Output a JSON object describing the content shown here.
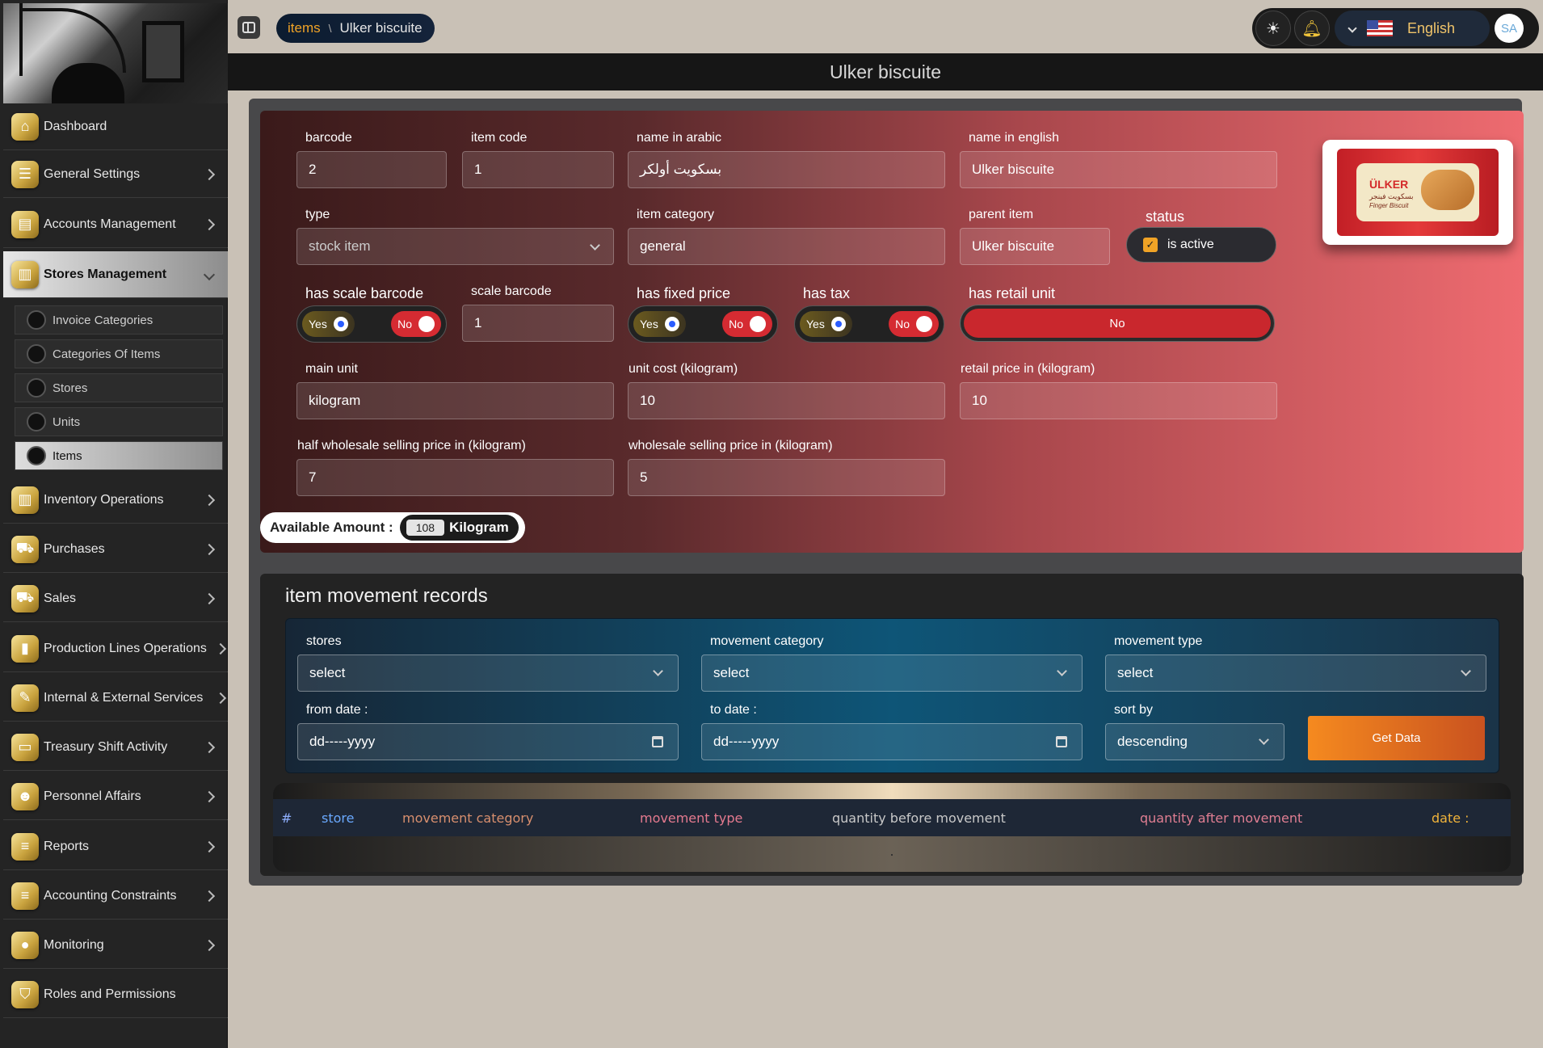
{
  "breadcrumb": {
    "parent": "items",
    "separator": "\\",
    "current": "Ulker biscuite"
  },
  "page_title": "Ulker biscuite",
  "language": "English",
  "avatar_initials": "SA",
  "sidebar": {
    "items": [
      {
        "label": "Dashboard",
        "icon": "home-icon",
        "has_children": false
      },
      {
        "label": "General Settings",
        "icon": "sliders-icon",
        "has_children": true
      },
      {
        "label": "Accounts Management",
        "icon": "wallet-icon",
        "has_children": true
      },
      {
        "label": "Stores Management",
        "icon": "building-icon",
        "has_children": true,
        "active": true
      },
      {
        "label": "Inventory Operations",
        "icon": "building-icon",
        "has_children": true
      },
      {
        "label": "Purchases",
        "icon": "cart-icon",
        "has_children": true
      },
      {
        "label": "Sales",
        "icon": "cart-icon",
        "has_children": true
      },
      {
        "label": "Production Lines Operations",
        "icon": "columns-icon",
        "has_children": true
      },
      {
        "label": "Internal & External Services",
        "icon": "tools-icon",
        "has_children": true
      },
      {
        "label": "Treasury Shift Activity",
        "icon": "cash-icon",
        "has_children": true
      },
      {
        "label": "Personnel Affairs",
        "icon": "people-icon",
        "has_children": true
      },
      {
        "label": "Reports",
        "icon": "list-icon",
        "has_children": true
      },
      {
        "label": "Accounting Constraints",
        "icon": "list-icon",
        "has_children": true
      },
      {
        "label": "Monitoring",
        "icon": "circle-icon",
        "has_children": true
      },
      {
        "label": "Roles and Permissions",
        "icon": "shield-icon",
        "has_children": false
      }
    ],
    "sub_items": [
      {
        "label": "Invoice Categories"
      },
      {
        "label": "Categories Of Items"
      },
      {
        "label": "Stores"
      },
      {
        "label": "Units"
      },
      {
        "label": "Items",
        "active": true
      }
    ]
  },
  "form": {
    "barcode": {
      "label": "barcode",
      "value": "2"
    },
    "item_code": {
      "label": "item code",
      "value": "1"
    },
    "name_ar": {
      "label": "name in arabic",
      "value": "بسكويت أولكر"
    },
    "name_en": {
      "label": "name in english",
      "value": "Ulker biscuite"
    },
    "type": {
      "label": "type",
      "value": "stock item"
    },
    "item_category": {
      "label": "item category",
      "value": "general"
    },
    "parent_item": {
      "label": "parent item",
      "value": "Ulker biscuite"
    },
    "status": {
      "label": "status",
      "value": "is active",
      "checked": true
    },
    "has_scale_barcode": {
      "label": "has scale barcode",
      "yes": "Yes",
      "no": "No",
      "selected": "Yes"
    },
    "scale_barcode": {
      "label": "scale barcode",
      "value": "1"
    },
    "has_fixed_price": {
      "label": "has fixed price",
      "yes": "Yes",
      "no": "No",
      "selected": "Yes"
    },
    "has_tax": {
      "label": "has tax",
      "yes": "Yes",
      "no": "No",
      "selected": "Yes"
    },
    "has_retail_unit": {
      "label": "has retail unit",
      "value": "No"
    },
    "main_unit": {
      "label": "main unit",
      "value": "kilogram"
    },
    "unit_cost": {
      "label": "unit cost (kilogram)",
      "value": "10"
    },
    "retail_price": {
      "label": "retail price in (kilogram)",
      "value": "10"
    },
    "half_wholesale": {
      "label": "half wholesale selling price in (kilogram)",
      "value": "7"
    },
    "wholesale": {
      "label": "wholesale selling price in (kilogram)",
      "value": "5"
    }
  },
  "product_image": {
    "brand": "ÜLKER",
    "subtitle_ar": "بسكويت فينجر",
    "subtitle_en": "Finger Biscuit"
  },
  "available": {
    "label": "Available Amount :",
    "value": "108",
    "unit": "Kilogram"
  },
  "movement": {
    "title": "item movement records",
    "filters": {
      "stores": {
        "label": "stores",
        "value": "select"
      },
      "movement_category": {
        "label": "movement category",
        "value": "select"
      },
      "movement_type": {
        "label": "movement type",
        "value": "select"
      },
      "from_date": {
        "label": "from date :",
        "value": "dd-----yyyy"
      },
      "to_date": {
        "label": "to date :",
        "value": "dd-----yyyy"
      },
      "sort_by": {
        "label": "sort by",
        "value": "descending"
      }
    },
    "get_data_label": "Get Data",
    "columns": [
      {
        "label": "#",
        "color": "#8fb0ff"
      },
      {
        "label": "store",
        "color": "#6aa9ff"
      },
      {
        "label": "movement category",
        "color": "#d88f6e"
      },
      {
        "label": "movement type",
        "color": "#e57a8f"
      },
      {
        "label": "quantity before movement",
        "color": "#c8c8c8"
      },
      {
        "label": "quantity after movement",
        "color": "#e07e92"
      },
      {
        "label": "date :",
        "color": "#f0b33a"
      }
    ]
  },
  "colors": {
    "accent": "#f0a326",
    "danger": "#d52b32",
    "button": "#f58a1f"
  }
}
